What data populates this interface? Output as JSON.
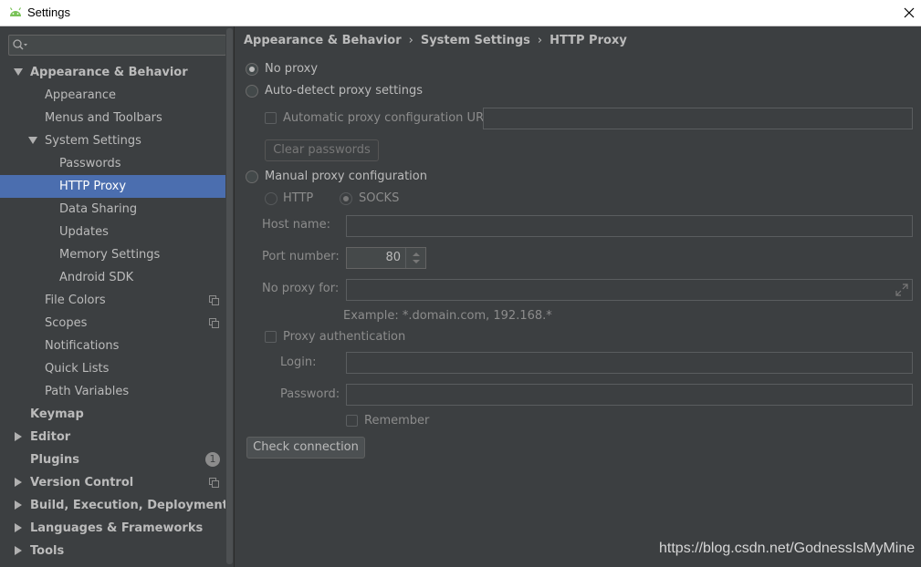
{
  "window": {
    "title": "Settings"
  },
  "search": {
    "placeholder": ""
  },
  "sidebar": {
    "items": [
      {
        "label": "Appearance & Behavior"
      },
      {
        "label": "Appearance"
      },
      {
        "label": "Menus and Toolbars"
      },
      {
        "label": "System Settings"
      },
      {
        "label": "Passwords"
      },
      {
        "label": "HTTP Proxy"
      },
      {
        "label": "Data Sharing"
      },
      {
        "label": "Updates"
      },
      {
        "label": "Memory Settings"
      },
      {
        "label": "Android SDK"
      },
      {
        "label": "File Colors"
      },
      {
        "label": "Scopes"
      },
      {
        "label": "Notifications"
      },
      {
        "label": "Quick Lists"
      },
      {
        "label": "Path Variables"
      },
      {
        "label": "Keymap"
      },
      {
        "label": "Editor"
      },
      {
        "label": "Plugins",
        "badge": "1"
      },
      {
        "label": "Version Control"
      },
      {
        "label": "Build, Execution, Deployment"
      },
      {
        "label": "Languages & Frameworks"
      },
      {
        "label": "Tools"
      }
    ]
  },
  "breadcrumb": {
    "level1": "Appearance & Behavior",
    "level2": "System Settings",
    "level3": "HTTP Proxy",
    "separator": "›"
  },
  "proxy": {
    "no_proxy": "No proxy",
    "auto_detect": "Auto-detect proxy settings",
    "auto_config_url": "Automatic proxy configuration URL:",
    "clear_passwords": "Clear passwords",
    "manual": "Manual proxy configuration",
    "http": "HTTP",
    "socks": "SOCKS",
    "host_name": "Host name:",
    "port_number": "Port number:",
    "port_value": "80",
    "no_proxy_for": "No proxy for:",
    "example": "Example: *.domain.com, 192.168.*",
    "proxy_auth": "Proxy authentication",
    "login": "Login:",
    "password": "Password:",
    "remember": "Remember",
    "check_connection": "Check connection"
  },
  "watermark": "https://blog.csdn.net/GodnessIsMyMine",
  "colors": {
    "selection": "#4b6eaf",
    "background": "#3c3f41",
    "text": "#bbbbbb"
  }
}
